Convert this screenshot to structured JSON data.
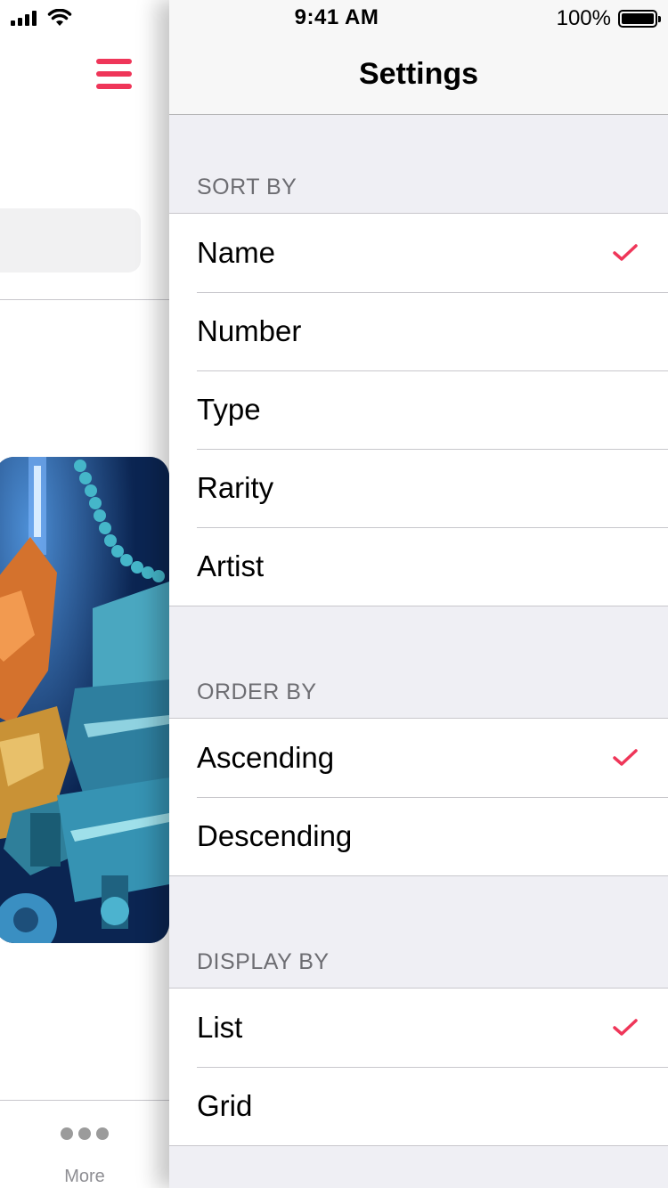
{
  "status_bar": {
    "time": "9:41 AM",
    "battery_percent": "100%"
  },
  "left_panel": {
    "menu_icon": "hamburger-icon",
    "more_tab": {
      "icon": "more-dots-icon",
      "label": "More"
    }
  },
  "settings": {
    "title": "Settings",
    "accent_color": "#ef3659",
    "sections": [
      {
        "header": "SORT BY",
        "options": [
          {
            "label": "Name",
            "selected": true
          },
          {
            "label": "Number",
            "selected": false
          },
          {
            "label": "Type",
            "selected": false
          },
          {
            "label": "Rarity",
            "selected": false
          },
          {
            "label": "Artist",
            "selected": false
          }
        ]
      },
      {
        "header": "ORDER BY",
        "options": [
          {
            "label": "Ascending",
            "selected": true
          },
          {
            "label": "Descending",
            "selected": false
          }
        ]
      },
      {
        "header": "DISPLAY BY",
        "options": [
          {
            "label": "List",
            "selected": true
          },
          {
            "label": "Grid",
            "selected": false
          }
        ]
      }
    ]
  }
}
